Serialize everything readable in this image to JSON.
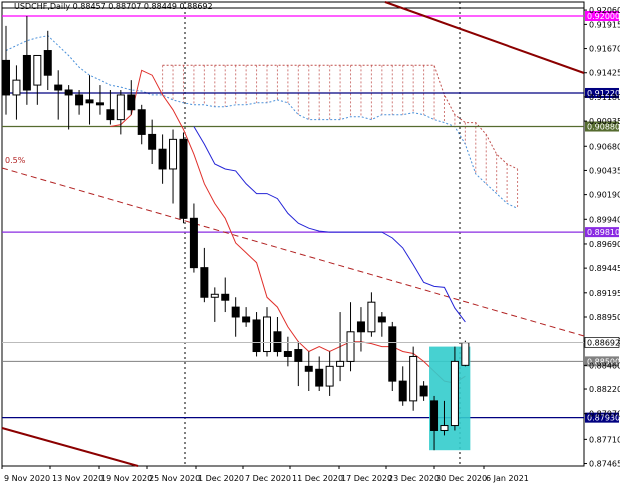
{
  "chart_data": {
    "type": "candlestick",
    "symbol_header": "USDCHF,Daily 0.88457 0.88707 0.88449 0.88692",
    "ylim": [
      0.8744,
      0.92
    ],
    "y_ticks": [
      "0.92060",
      "0.91915",
      "0.91670",
      "0.91425",
      "0.91180",
      "0.90935",
      "0.90680",
      "0.90435",
      "0.90190",
      "0.89940",
      "0.89690",
      "0.89445",
      "0.89195",
      "0.88950",
      "0.88705",
      "0.88460",
      "0.88220",
      "0.87970",
      "0.87710",
      "0.87465"
    ],
    "x_labels": [
      "9 Nov 2020",
      "13 Nov 2020",
      "19 Nov 2020",
      "25 Nov 2020",
      "1 Dec 2020",
      "7 Dec 2020",
      "11 Dec 2020",
      "17 Dec 2020",
      "23 Dec 2020",
      "30 Dec 2020",
      "6 Jan 2021"
    ],
    "fib_label": "0.5%",
    "levels": [
      {
        "label": "0.92000",
        "value": 0.92,
        "color": "#ff00ff"
      },
      {
        "label": "0.91220",
        "value": 0.9122,
        "color": "#000080"
      },
      {
        "label": "0.90880",
        "value": 0.9088,
        "color": "#556b2f"
      },
      {
        "label": "0.89810",
        "value": 0.8981,
        "color": "#8a2be2"
      },
      {
        "label": "0.88500",
        "value": 0.885,
        "color": "#808080"
      },
      {
        "label": "0.87930",
        "value": 0.8793,
        "color": "#000080"
      }
    ],
    "current_price": {
      "label": "0.88692",
      "value": 0.88692
    },
    "candles": [
      {
        "o": 0.9155,
        "h": 0.919,
        "l": 0.91,
        "c": 0.912
      },
      {
        "o": 0.912,
        "h": 0.915,
        "l": 0.9095,
        "c": 0.9135
      },
      {
        "o": 0.916,
        "h": 0.92,
        "l": 0.911,
        "c": 0.9125
      },
      {
        "o": 0.913,
        "h": 0.916,
        "l": 0.911,
        "c": 0.916
      },
      {
        "o": 0.9165,
        "h": 0.9185,
        "l": 0.9125,
        "c": 0.914
      },
      {
        "o": 0.913,
        "h": 0.9145,
        "l": 0.9095,
        "c": 0.9125
      },
      {
        "o": 0.9125,
        "h": 0.913,
        "l": 0.9085,
        "c": 0.912
      },
      {
        "o": 0.912,
        "h": 0.9125,
        "l": 0.91,
        "c": 0.911
      },
      {
        "o": 0.9115,
        "h": 0.914,
        "l": 0.909,
        "c": 0.9112
      },
      {
        "o": 0.9112,
        "h": 0.913,
        "l": 0.91,
        "c": 0.911
      },
      {
        "o": 0.9105,
        "h": 0.9125,
        "l": 0.909,
        "c": 0.9095
      },
      {
        "o": 0.9095,
        "h": 0.9125,
        "l": 0.908,
        "c": 0.912
      },
      {
        "o": 0.912,
        "h": 0.9135,
        "l": 0.91,
        "c": 0.9105
      },
      {
        "o": 0.9105,
        "h": 0.911,
        "l": 0.907,
        "c": 0.908
      },
      {
        "o": 0.908,
        "h": 0.9095,
        "l": 0.905,
        "c": 0.9065
      },
      {
        "o": 0.9065,
        "h": 0.908,
        "l": 0.903,
        "c": 0.9045
      },
      {
        "o": 0.9045,
        "h": 0.9085,
        "l": 0.901,
        "c": 0.9075
      },
      {
        "o": 0.9075,
        "h": 0.9082,
        "l": 0.899,
        "c": 0.8995
      },
      {
        "o": 0.8995,
        "h": 0.901,
        "l": 0.894,
        "c": 0.8945
      },
      {
        "o": 0.8945,
        "h": 0.8965,
        "l": 0.891,
        "c": 0.8915
      },
      {
        "o": 0.8915,
        "h": 0.8925,
        "l": 0.889,
        "c": 0.8918
      },
      {
        "o": 0.8918,
        "h": 0.8935,
        "l": 0.89,
        "c": 0.8912
      },
      {
        "o": 0.8905,
        "h": 0.8915,
        "l": 0.8875,
        "c": 0.8895
      },
      {
        "o": 0.8895,
        "h": 0.8905,
        "l": 0.8885,
        "c": 0.889
      },
      {
        "o": 0.8892,
        "h": 0.89,
        "l": 0.8855,
        "c": 0.886
      },
      {
        "o": 0.886,
        "h": 0.8905,
        "l": 0.8855,
        "c": 0.8895
      },
      {
        "o": 0.888,
        "h": 0.8895,
        "l": 0.8855,
        "c": 0.886
      },
      {
        "o": 0.886,
        "h": 0.8875,
        "l": 0.8845,
        "c": 0.8855
      },
      {
        "o": 0.8862,
        "h": 0.887,
        "l": 0.8825,
        "c": 0.885
      },
      {
        "o": 0.8845,
        "h": 0.886,
        "l": 0.882,
        "c": 0.884
      },
      {
        "o": 0.8842,
        "h": 0.8855,
        "l": 0.882,
        "c": 0.8825
      },
      {
        "o": 0.8825,
        "h": 0.886,
        "l": 0.8815,
        "c": 0.8845
      },
      {
        "o": 0.8845,
        "h": 0.89,
        "l": 0.883,
        "c": 0.885
      },
      {
        "o": 0.885,
        "h": 0.891,
        "l": 0.884,
        "c": 0.888
      },
      {
        "o": 0.889,
        "h": 0.8905,
        "l": 0.886,
        "c": 0.888
      },
      {
        "o": 0.888,
        "h": 0.892,
        "l": 0.8875,
        "c": 0.891
      },
      {
        "o": 0.8895,
        "h": 0.89,
        "l": 0.8875,
        "c": 0.889
      },
      {
        "o": 0.8885,
        "h": 0.889,
        "l": 0.882,
        "c": 0.883
      },
      {
        "o": 0.883,
        "h": 0.8845,
        "l": 0.8805,
        "c": 0.881
      },
      {
        "o": 0.881,
        "h": 0.8865,
        "l": 0.88,
        "c": 0.8855
      },
      {
        "o": 0.8825,
        "h": 0.883,
        "l": 0.881,
        "c": 0.8815
      },
      {
        "o": 0.881,
        "h": 0.8815,
        "l": 0.876,
        "c": 0.878
      },
      {
        "o": 0.878,
        "h": 0.881,
        "l": 0.8775,
        "c": 0.8785
      },
      {
        "o": 0.8785,
        "h": 0.8865,
        "l": 0.878,
        "c": 0.885
      },
      {
        "o": 0.8846,
        "h": 0.8871,
        "l": 0.8845,
        "c": 0.8869
      }
    ],
    "cloud_upper": [
      null,
      null,
      null,
      null,
      null,
      null,
      null,
      null,
      null,
      null,
      null,
      null,
      null,
      null,
      null,
      0.915,
      0.915,
      0.915,
      0.915,
      0.915,
      0.915,
      0.915,
      0.915,
      0.915,
      0.915,
      0.915,
      0.915,
      0.915,
      0.915,
      0.915,
      0.915,
      0.915,
      0.915,
      0.915,
      0.915,
      0.915,
      0.915,
      0.915,
      0.915,
      0.915,
      0.915,
      0.915,
      0.912,
      0.91,
      0.9092,
      0.9092,
      0.908,
      0.906,
      0.905,
      0.9045
    ],
    "cloud_lower": [
      0.9165,
      0.917,
      0.9175,
      0.9178,
      0.918,
      0.917,
      0.916,
      0.9148,
      0.914,
      0.9135,
      0.913,
      0.9128,
      0.9125,
      0.9124,
      0.912,
      0.912,
      0.9115,
      0.9112,
      0.911,
      0.911,
      0.9108,
      0.9108,
      0.911,
      0.911,
      0.9112,
      0.9112,
      0.9115,
      0.9112,
      0.91,
      0.9095,
      0.9095,
      0.9095,
      0.9095,
      0.9098,
      0.9098,
      0.9095,
      0.91,
      0.91,
      0.91,
      0.9102,
      0.91,
      0.9095,
      0.9092,
      0.9088,
      0.907,
      0.904,
      0.903,
      0.902,
      0.901,
      0.9005
    ],
    "red_ma": [
      null,
      null,
      null,
      null,
      null,
      null,
      null,
      null,
      null,
      null,
      0.9088,
      0.909,
      0.91,
      0.9145,
      0.914,
      0.912,
      0.9105,
      0.9085,
      0.906,
      0.903,
      0.901,
      0.8995,
      0.897,
      0.896,
      0.895,
      0.8915,
      0.8905,
      0.8885,
      0.887,
      0.886,
      0.8865,
      0.886,
      0.8865,
      0.887,
      0.887,
      0.8868,
      0.8865,
      0.8865,
      0.886,
      0.8858,
      0.885,
      0.884,
      0.883,
      0.8828,
      0.8835
    ],
    "blue_ma": [
      null,
      null,
      null,
      null,
      null,
      null,
      null,
      null,
      null,
      null,
      null,
      null,
      null,
      null,
      null,
      null,
      null,
      null,
      0.9088,
      0.907,
      0.905,
      0.9045,
      0.9043,
      0.903,
      0.902,
      0.902,
      0.9015,
      0.9,
      0.899,
      0.8985,
      0.8982,
      0.8981,
      0.8981,
      0.8981,
      0.8981,
      0.8981,
      0.8981,
      0.8975,
      0.8965,
      0.8948,
      0.893,
      0.8926,
      0.8925,
      0.8904,
      0.889
    ],
    "highlight_box": {
      "from_index": 41,
      "to_index": 44,
      "top": 0.8865,
      "bottom": 0.876
    }
  }
}
